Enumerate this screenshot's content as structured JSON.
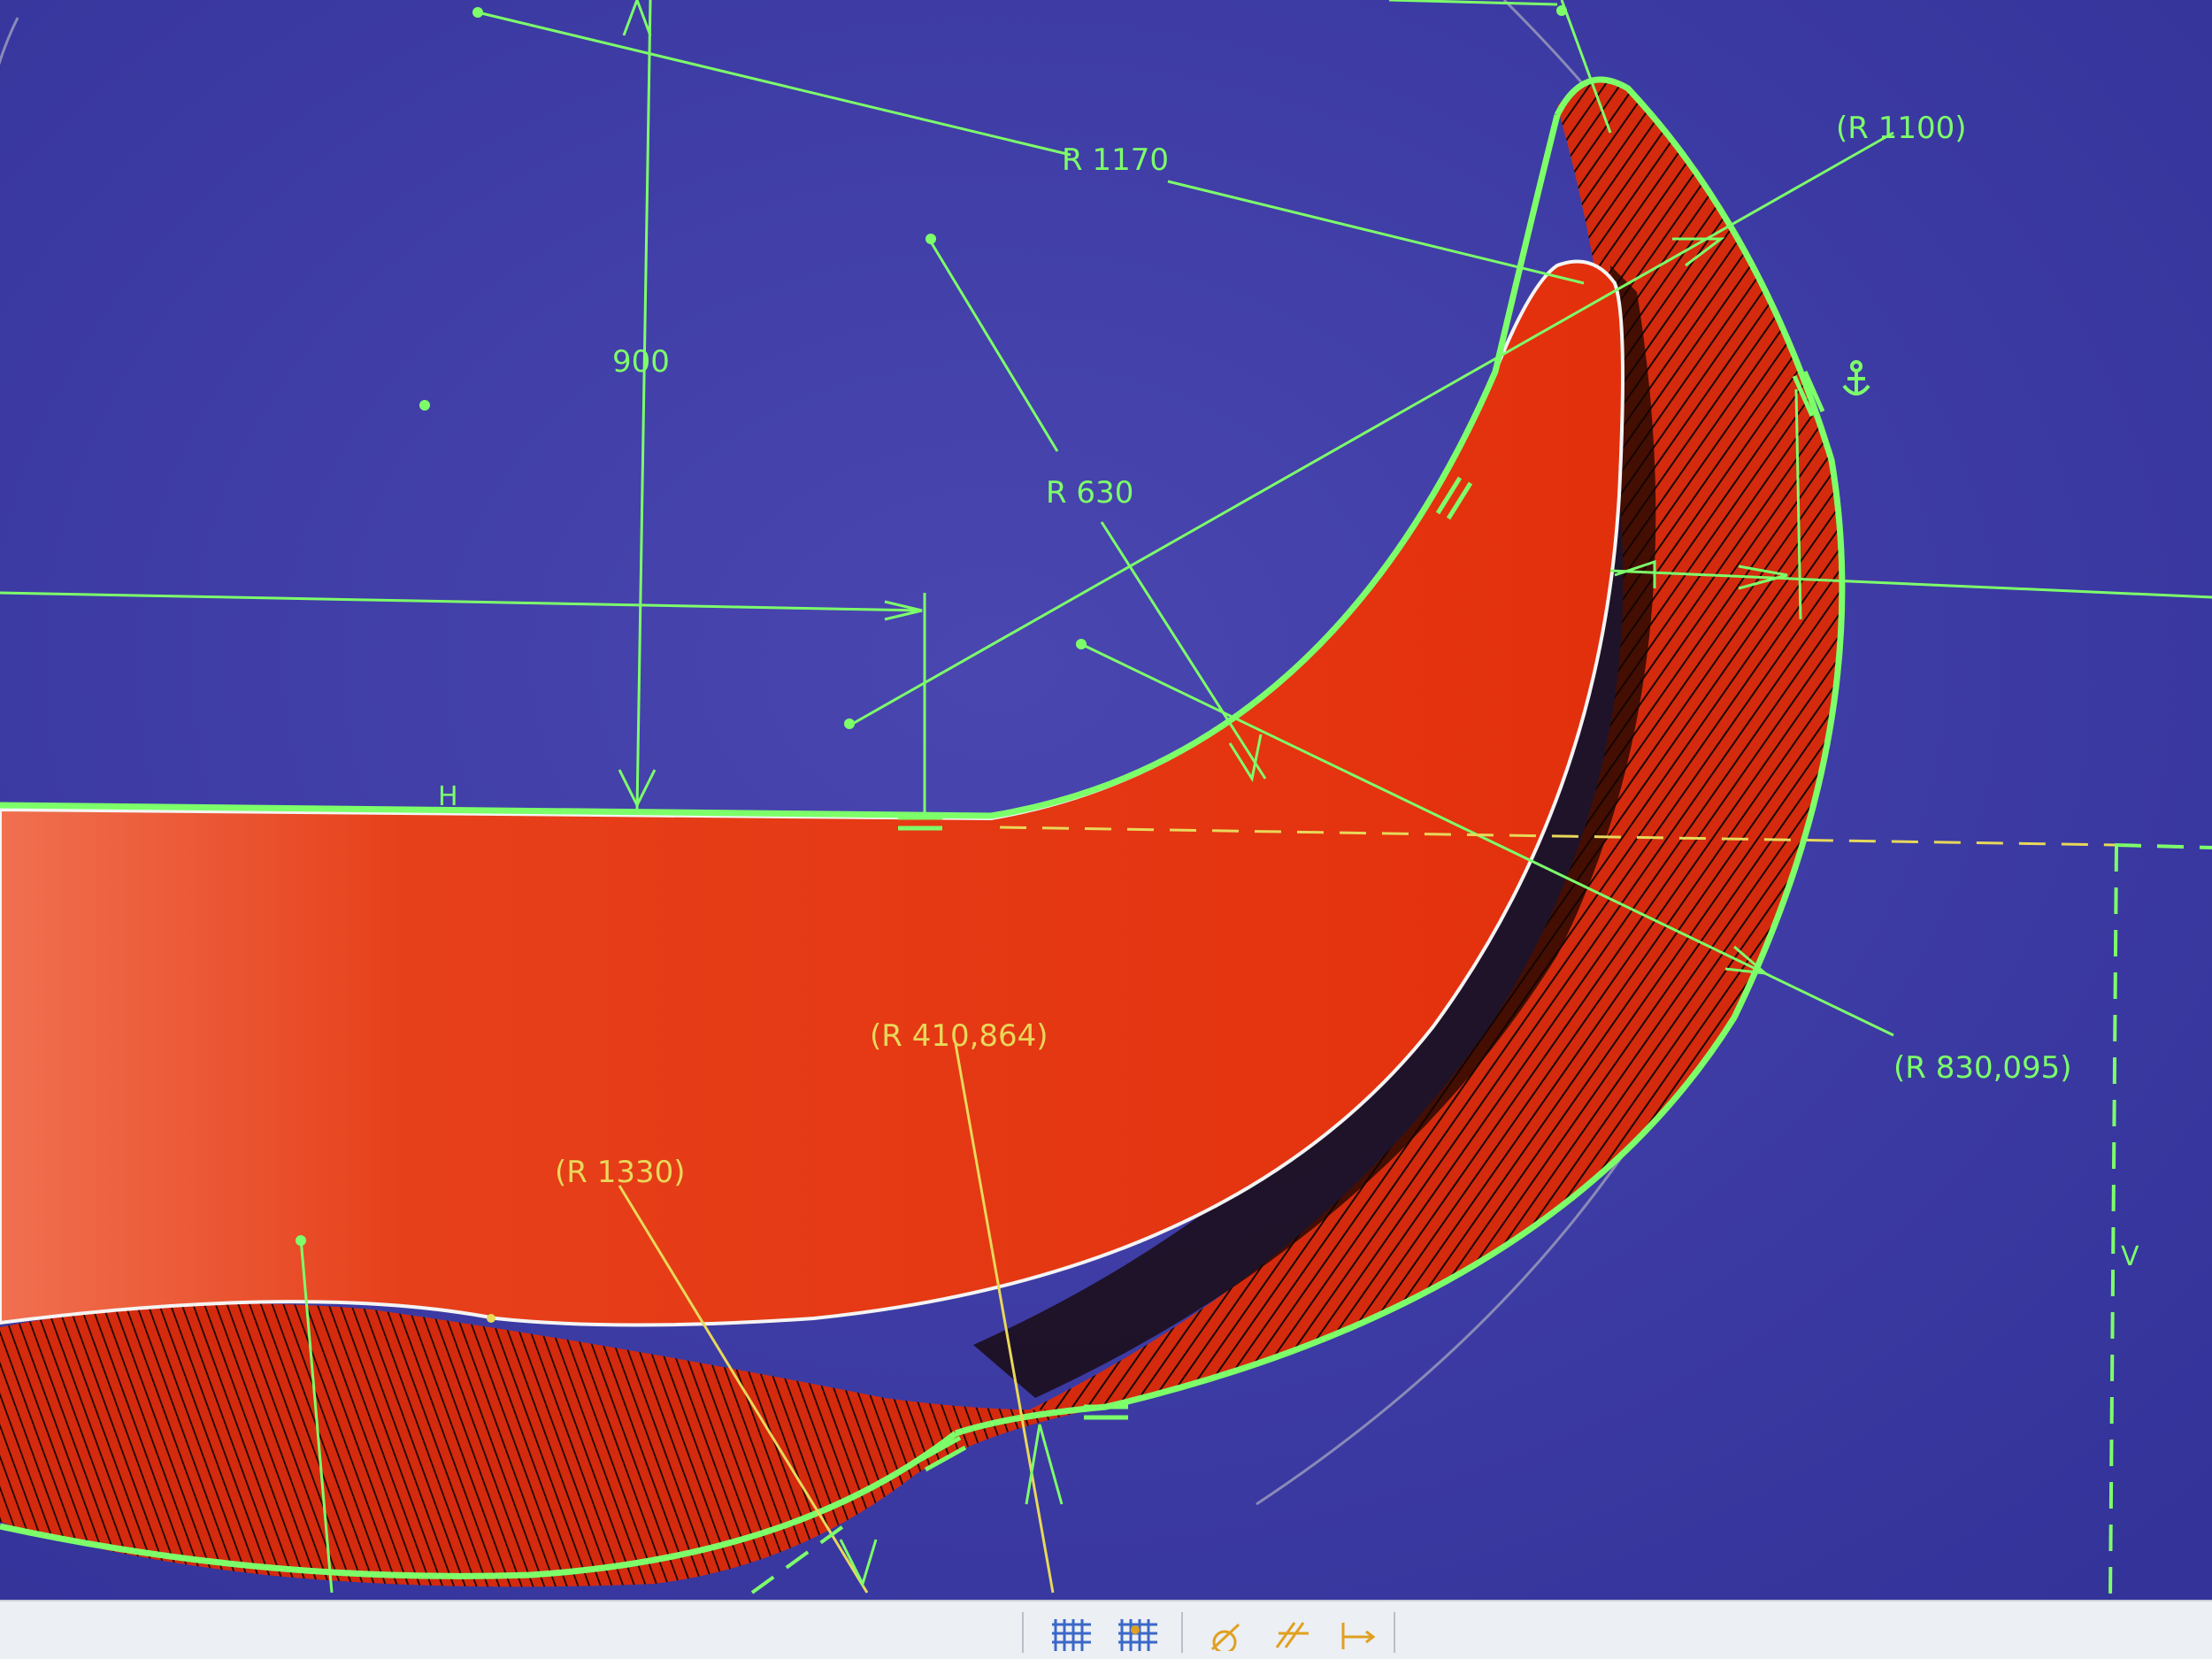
{
  "canvas": {
    "background": "#3a3a9e",
    "sketch_color": "#7dff6a",
    "driven_dim_color": "#e8d85a",
    "fill_color": "#e23a12"
  },
  "dimensions": {
    "r1170": "R 1170",
    "r1100": "(R 1100)",
    "d900": "900",
    "r630": "R 630",
    "r410": "(R 410,864)",
    "r830": "(R 830,095)",
    "r1330": "(R 1330)"
  },
  "constraints": {
    "horizontal": "H",
    "vertical": "V"
  },
  "icons": {
    "anchor": "anchor-icon"
  },
  "toolbar": {
    "buttons": [
      "grid-icon",
      "grid-snap-icon",
      "sketch-constraint-icon",
      "trim-icon",
      "dimension-icon"
    ]
  }
}
